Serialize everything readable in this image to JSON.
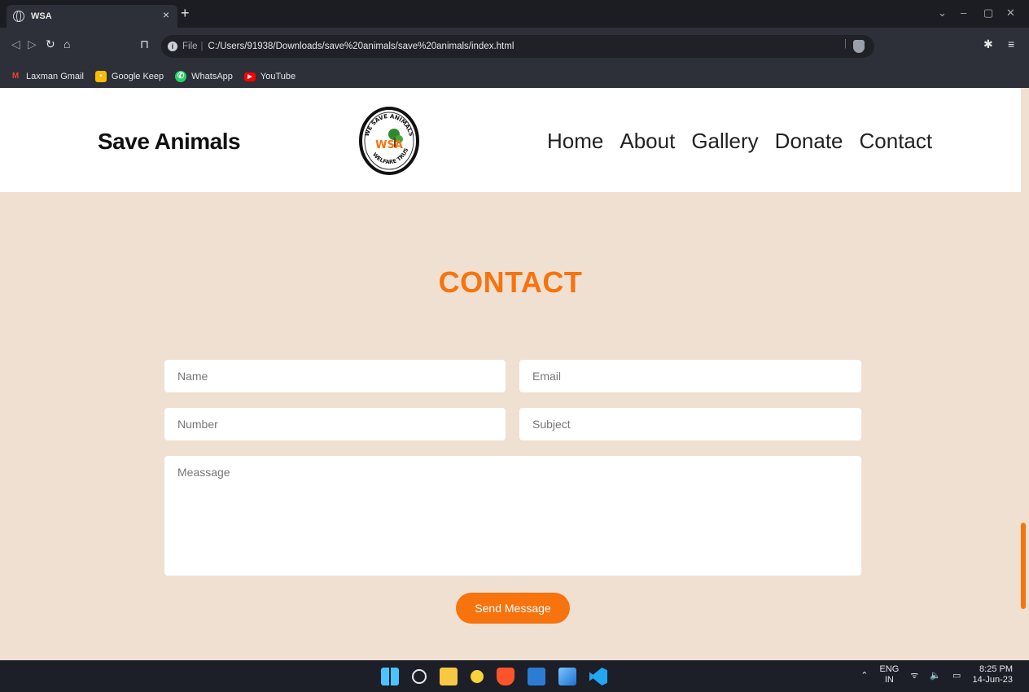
{
  "browser": {
    "tab_title": "WSA",
    "tab_close": "×",
    "new_tab": "+",
    "url_prefix": "File",
    "url": "C:/Users/91938/Downloads/save%20animals/save%20animals/index.html",
    "bookmarks": [
      {
        "label": "Laxman Gmail",
        "icon": "gmail-icon",
        "color": "#ea4335"
      },
      {
        "label": "Google Keep",
        "icon": "google-keep-icon",
        "color": "#fbbc04"
      },
      {
        "label": "WhatsApp",
        "icon": "whatsapp-icon",
        "color": "#25d366"
      },
      {
        "label": "YouTube",
        "icon": "youtube-icon",
        "color": "#ff0000"
      }
    ]
  },
  "site": {
    "brand": "Save Animals",
    "logo": {
      "top_text": "WE SAVE ANIMALS",
      "center_text": "WSA",
      "bottom_text": "WELFARE TRUST"
    },
    "nav": [
      "Home",
      "About",
      "Gallery",
      "Donate",
      "Contact"
    ],
    "accent_color": "#f7730d",
    "section_bg": "#f0e0d2"
  },
  "contact": {
    "title": "CONTACT",
    "name_placeholder": "Name",
    "email_placeholder": "Email",
    "number_placeholder": "Number",
    "subject_placeholder": "Subject",
    "message_placeholder": "Meassage",
    "send_label": "Send Message"
  },
  "taskbar": {
    "lang_top": "ENG",
    "lang_bottom": "IN",
    "time": "8:25 PM",
    "date": "14-Jun-23",
    "apps": [
      "windows-start-icon",
      "search-icon",
      "file-explorer-icon",
      "weather-icon",
      "brave-icon",
      "word-icon",
      "photos-icon",
      "vscode-icon"
    ]
  }
}
